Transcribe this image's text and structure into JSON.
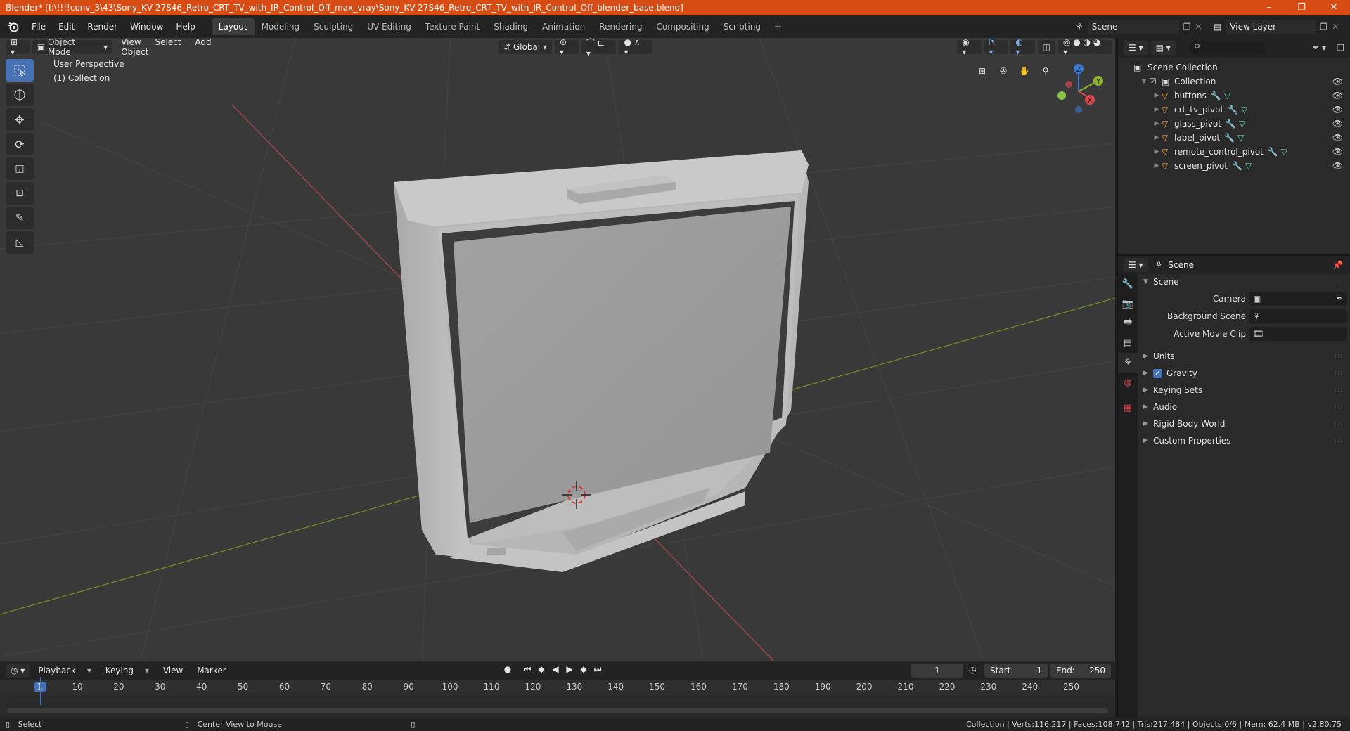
{
  "titlebar": {
    "title": "Blender* [I:\\!!!!conv_3\\43\\Sony_KV-27S46_Retro_CRT_TV_with_IR_Control_Off_max_vray\\Sony_KV-27S46_Retro_CRT_TV_with_IR_Control_Off_blender_base.blend]",
    "minimize": "–",
    "restore": "❐",
    "close": "✕"
  },
  "menu": [
    "File",
    "Edit",
    "Render",
    "Window",
    "Help"
  ],
  "workspaces": [
    "Layout",
    "Modeling",
    "Sculpting",
    "UV Editing",
    "Texture Paint",
    "Shading",
    "Animation",
    "Rendering",
    "Compositing",
    "Scripting"
  ],
  "workspace_active": "Layout",
  "scene_name": "Scene",
  "view_layer": "View Layer",
  "viewport": {
    "mode": "Object Mode",
    "menus": [
      "View",
      "Select",
      "Add",
      "Object"
    ],
    "transform_orientation": "Global",
    "perspective_label": "User Perspective",
    "collection_label": "(1) Collection"
  },
  "gizmo_axes": {
    "z": "Z",
    "y": "Y",
    "x": "X"
  },
  "outliner": {
    "root": "Scene Collection",
    "collection": "Collection",
    "objects": [
      "buttons",
      "crt_tv_pivot",
      "glass_pivot",
      "label_pivot",
      "remote_control_pivot",
      "screen_pivot"
    ]
  },
  "properties": {
    "context": "Scene",
    "panel": "Scene",
    "camera_label": "Camera",
    "background_scene_label": "Background Scene",
    "active_movie_clip_label": "Active Movie Clip",
    "subpanels": {
      "units": "Units",
      "gravity": "Gravity",
      "keying_sets": "Keying Sets",
      "audio": "Audio",
      "rigid_body_world": "Rigid Body World",
      "custom_properties": "Custom Properties"
    },
    "gravity_checked": true
  },
  "timeline": {
    "menus": [
      "Playback",
      "Keying",
      "View",
      "Marker"
    ],
    "current_frame": "1",
    "start_label": "Start:",
    "start_value": "1",
    "end_label": "End:",
    "end_value": "250",
    "ticks": [
      "1",
      "10",
      "20",
      "30",
      "40",
      "50",
      "60",
      "70",
      "80",
      "90",
      "100",
      "110",
      "120",
      "130",
      "140",
      "150",
      "160",
      "170",
      "180",
      "190",
      "200",
      "210",
      "220",
      "230",
      "240",
      "250"
    ]
  },
  "statusbar": {
    "select": "Select",
    "center_view": "Center View to Mouse",
    "stats": "Collection | Verts:116,217 | Faces:108,742 | Tris:217,484 | Objects:0/6 | Mem: 62.4 MB | v2.80.75"
  },
  "colors": {
    "accent": "#4772b3",
    "titlebar": "#d74c14",
    "mesh_icon": "#f29c38",
    "axis_x": "#d9474d",
    "axis_y": "#8bb42c",
    "axis_z": "#3c7ad8"
  }
}
